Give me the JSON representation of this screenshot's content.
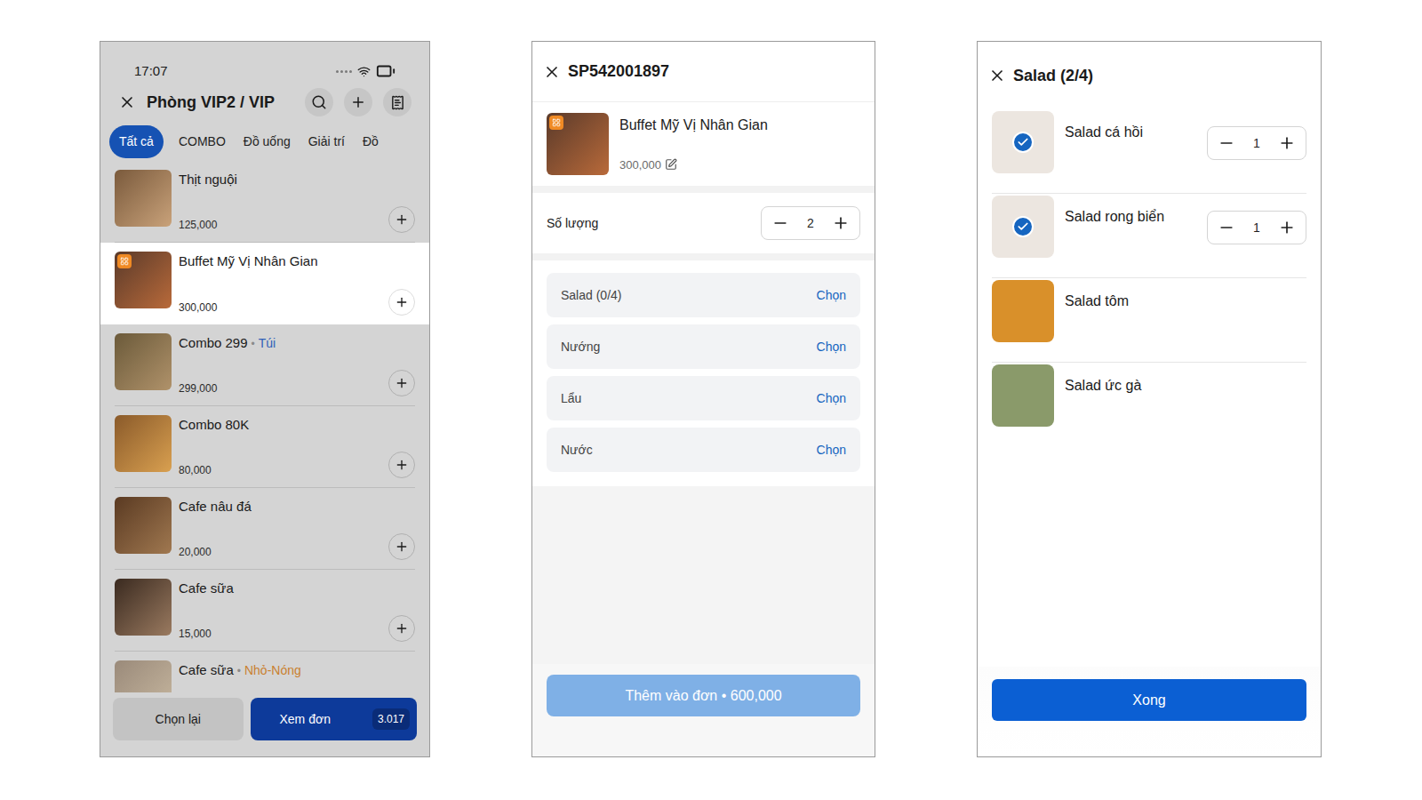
{
  "menu_screen": {
    "status_bar": {
      "time": "17:07"
    },
    "title": "Phòng VIP2 / VIP",
    "tabs": [
      {
        "label": "Tất cả",
        "selected": true
      },
      {
        "label": "COMBO",
        "selected": false
      },
      {
        "label": "Đồ uống",
        "selected": false
      },
      {
        "label": "Giải trí",
        "selected": false
      },
      {
        "label": "Đồ",
        "selected": false
      }
    ],
    "items": [
      {
        "name": "Thịt nguội",
        "price": "125,000",
        "highlighted": false,
        "combo": false
      },
      {
        "name": "Buffet Mỹ Vị Nhân Gian",
        "price": "300,000",
        "highlighted": true,
        "combo": true
      },
      {
        "name": "Combo 299",
        "dot": "•",
        "tag": "Túi",
        "color": "#2f5fb8",
        "price": "299,000",
        "highlighted": false,
        "combo": false
      },
      {
        "name": "Combo 80K",
        "price": "80,000",
        "highlighted": false,
        "combo": false
      },
      {
        "name": "Cafe nâu đá",
        "price": "20,000",
        "highlighted": false,
        "combo": false
      },
      {
        "name": "Cafe sữa",
        "price": "15,000",
        "highlighted": false,
        "combo": false
      },
      {
        "name": "Cafe sữa",
        "dot": "•",
        "tag": "Nhỏ-Nóng",
        "color": "#c9802f",
        "highlighted": false,
        "combo": false
      }
    ],
    "buttons": {
      "reset": "Chọn lại",
      "view": "Xem đơn",
      "count": "3.017"
    }
  },
  "detail_screen": {
    "code": "SP542001897",
    "product": {
      "name": "Buffet Mỹ Vị Nhân Gian",
      "price": "300,000",
      "combo": true
    },
    "quantity_label": "Số lượng",
    "quantity": "2",
    "groups": [
      {
        "label": "Salad (0/4)",
        "action": "Chọn"
      },
      {
        "label": "Nướng",
        "action": "Chọn"
      },
      {
        "label": "Lẩu",
        "action": "Chọn"
      },
      {
        "label": "Nước",
        "action": "Chọn"
      }
    ],
    "submit": {
      "label": "Thêm vào đơn • 600,000",
      "disabled": true
    }
  },
  "picker_screen": {
    "title": "Salad (2/4)",
    "items": [
      {
        "name": "Salad cá hồi",
        "checked": true,
        "quantity": "1"
      },
      {
        "name": "Salad rong biển",
        "checked": true,
        "quantity": "1"
      },
      {
        "name": "Salad tôm",
        "checked": false
      },
      {
        "name": "Salad ức gà",
        "checked": false
      }
    ],
    "done": "Xong"
  }
}
